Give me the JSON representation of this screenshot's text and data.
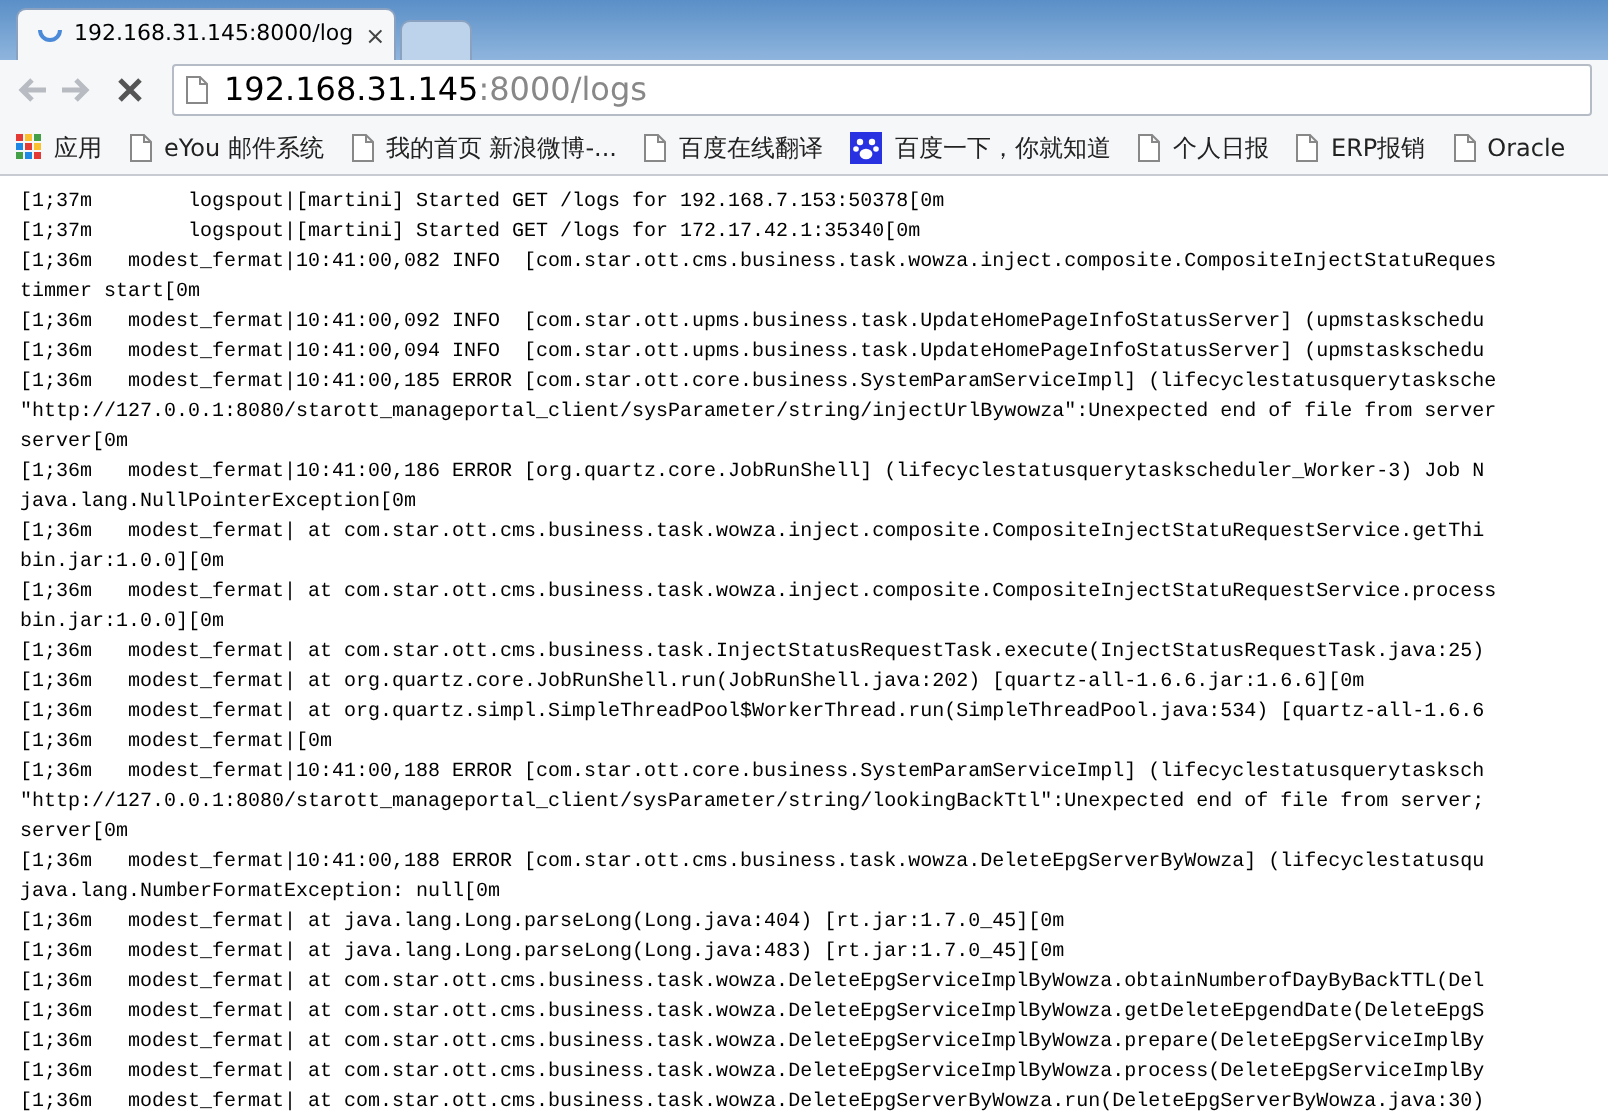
{
  "tabs": [
    {
      "title": "192.168.31.145:8000/log",
      "loading": true,
      "close": "×",
      "selected": true
    },
    {
      "loading": false,
      "selected": false
    }
  ],
  "toolbar": {
    "address": {
      "host": "192.168.31.145",
      "rest": ":8000/logs"
    }
  },
  "bookmarks": [
    {
      "kind": "apps",
      "label": "应用"
    },
    {
      "kind": "page",
      "label": "eYou 邮件系统"
    },
    {
      "kind": "page",
      "label": "我的首页 新浪微博-..."
    },
    {
      "kind": "page",
      "label": "百度在线翻译"
    },
    {
      "kind": "paw",
      "label": "百度一下，你就知道"
    },
    {
      "kind": "page",
      "label": "个人日报"
    },
    {
      "kind": "page",
      "label": "ERP报销"
    },
    {
      "kind": "page",
      "label": "Oracle"
    }
  ],
  "log_lines": [
    "[1;37m        logspout|[martini] Started GET /logs for 192.168.7.153:50378[0m",
    "[1;37m        logspout|[martini] Started GET /logs for 172.17.42.1:35340[0m",
    "[1;36m   modest_fermat|10:41:00,082 INFO  [com.star.ott.cms.business.task.wowza.inject.composite.CompositeInjectStatuReques",
    "timmer start[0m",
    "[1;36m   modest_fermat|10:41:00,092 INFO  [com.star.ott.upms.business.task.UpdateHomePageInfoStatusServer] (upmstaskschedu",
    "[1;36m   modest_fermat|10:41:00,094 INFO  [com.star.ott.upms.business.task.UpdateHomePageInfoStatusServer] (upmstaskschedu",
    "[1;36m   modest_fermat|10:41:00,185 ERROR [com.star.ott.core.business.SystemParamServiceImpl] (lifecyclestatusquerytasksche",
    "\"http://127.0.0.1:8080/starott_manageportal_client/sysParameter/string/injectUrlBywowza\":Unexpected end of file from server",
    "server[0m",
    "[1;36m   modest_fermat|10:41:00,186 ERROR [org.quartz.core.JobRunShell] (lifecyclestatusquerytaskscheduler_Worker-3) Job N",
    "java.lang.NullPointerException[0m",
    "[1;36m   modest_fermat| at com.star.ott.cms.business.task.wowza.inject.composite.CompositeInjectStatuRequestService.getThi",
    "bin.jar:1.0.0][0m",
    "[1;36m   modest_fermat| at com.star.ott.cms.business.task.wowza.inject.composite.CompositeInjectStatuRequestService.process",
    "bin.jar:1.0.0][0m",
    "[1;36m   modest_fermat| at com.star.ott.cms.business.task.InjectStatusRequestTask.execute(InjectStatusRequestTask.java:25)",
    "[1;36m   modest_fermat| at org.quartz.core.JobRunShell.run(JobRunShell.java:202) [quartz-all-1.6.6.jar:1.6.6][0m",
    "[1;36m   modest_fermat| at org.quartz.simpl.SimpleThreadPool$WorkerThread.run(SimpleThreadPool.java:534) [quartz-all-1.6.6",
    "[1;36m   modest_fermat|[0m",
    "[1;36m   modest_fermat|10:41:00,188 ERROR [com.star.ott.core.business.SystemParamServiceImpl] (lifecyclestatusquerytasksch",
    "\"http://127.0.0.1:8080/starott_manageportal_client/sysParameter/string/lookingBackTtl\":Unexpected end of file from server;",
    "server[0m",
    "[1;36m   modest_fermat|10:41:00,188 ERROR [com.star.ott.cms.business.task.wowza.DeleteEpgServerByWowza] (lifecyclestatusqu",
    "java.lang.NumberFormatException: null[0m",
    "[1;36m   modest_fermat| at java.lang.Long.parseLong(Long.java:404) [rt.jar:1.7.0_45][0m",
    "[1;36m   modest_fermat| at java.lang.Long.parseLong(Long.java:483) [rt.jar:1.7.0_45][0m",
    "[1;36m   modest_fermat| at com.star.ott.cms.business.task.wowza.DeleteEpgServiceImplByWowza.obtainNumberofDayByBackTTL(Del",
    "[1;36m   modest_fermat| at com.star.ott.cms.business.task.wowza.DeleteEpgServiceImplByWowza.getDeleteEpgendDate(DeleteEpgS",
    "[1;36m   modest_fermat| at com.star.ott.cms.business.task.wowza.DeleteEpgServiceImplByWowza.prepare(DeleteEpgServiceImplBy",
    "[1;36m   modest_fermat| at com.star.ott.cms.business.task.wowza.DeleteEpgServiceImplByWowza.process(DeleteEpgServiceImplBy",
    "[1;36m   modest_fermat| at com.star.ott.cms.business.task.wowza.DeleteEpgServerByWowza.run(DeleteEpgServerByWowza.java:30)"
  ]
}
